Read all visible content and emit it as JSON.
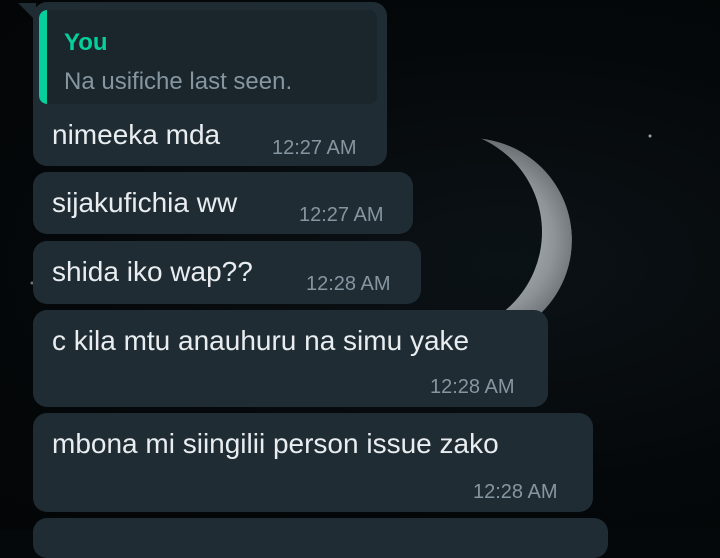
{
  "chat": {
    "quoted": {
      "author": "You",
      "text": "Na usifiche last seen."
    },
    "messages": [
      {
        "text": "nimeeka mda",
        "time": "12:27 AM"
      },
      {
        "text": "sijakufichia ww",
        "time": "12:27 AM"
      },
      {
        "text": "shida iko wap??",
        "time": "12:28 AM"
      },
      {
        "text": "c kila mtu anauhuru na simu yake",
        "time": "12:28 AM"
      },
      {
        "text": "mbona mi siingilii person issue zako",
        "time": "12:28 AM"
      }
    ]
  },
  "colors": {
    "bubble_background": "#1f2c34",
    "message_text": "#e9edef",
    "timestamp_text": "#8696a0",
    "quote_accent": "#06cf9c",
    "wallpaper": "#05080a"
  },
  "wallpaper": {
    "icon": "crescent-moon"
  }
}
